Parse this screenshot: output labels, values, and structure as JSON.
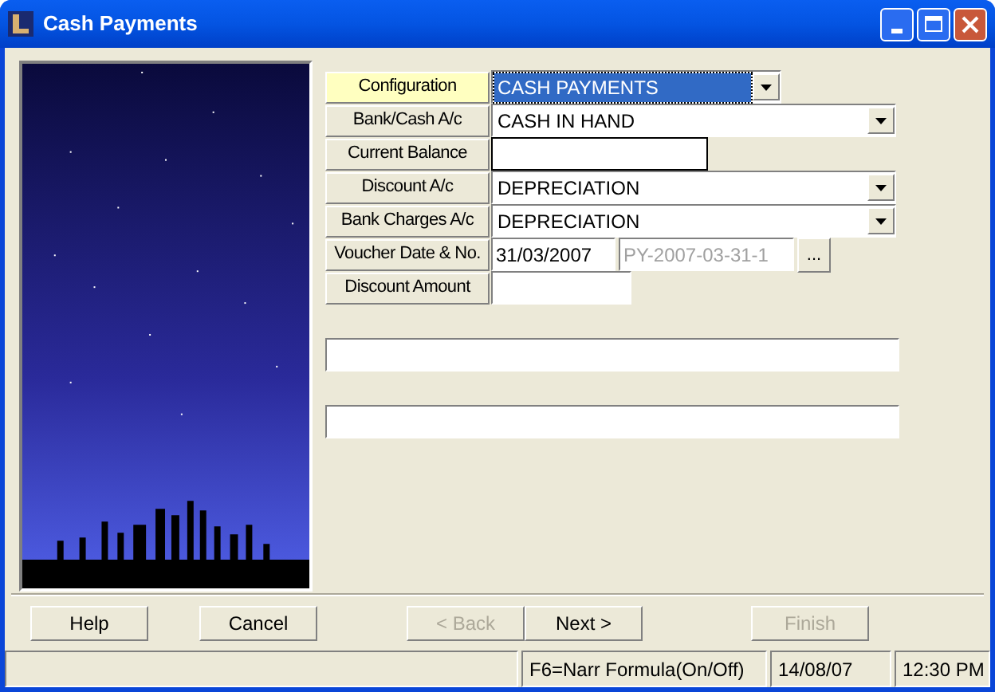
{
  "window": {
    "title": "Cash Payments"
  },
  "form": {
    "rows": [
      {
        "label": "Configuration",
        "kind": "combo",
        "value": "CASH PAYMENTS",
        "focused": true
      },
      {
        "label": "Bank/Cash A/c",
        "kind": "dropdown",
        "value": "CASH IN HAND",
        "focused": false
      },
      {
        "label": "Current Balance",
        "kind": "box",
        "focused": false
      },
      {
        "label": "Discount A/c",
        "kind": "dropdown",
        "value": "DEPRECIATION",
        "focused": false
      },
      {
        "label": "Bank Charges A/c",
        "kind": "dropdown",
        "value": "DEPRECIATION",
        "focused": false
      },
      {
        "label": "Voucher Date & No.",
        "kind": "voucher",
        "value": "31/03/2007",
        "number": "PY-2007-03-31-1",
        "button": "...",
        "focused": false
      },
      {
        "label": "Discount Amount",
        "kind": "text",
        "focused": false
      }
    ]
  },
  "buttons": [
    {
      "label": "Help",
      "disabled": false
    },
    {
      "label": "Cancel",
      "disabled": false
    },
    {
      "label": "< Back",
      "disabled": true
    },
    {
      "label": "Next >",
      "disabled": false
    },
    {
      "label": "Finish",
      "disabled": true
    }
  ],
  "status_bar": [
    "F6=Narr Formula(On/Off)",
    "14/08/07",
    "12:30 PM"
  ]
}
